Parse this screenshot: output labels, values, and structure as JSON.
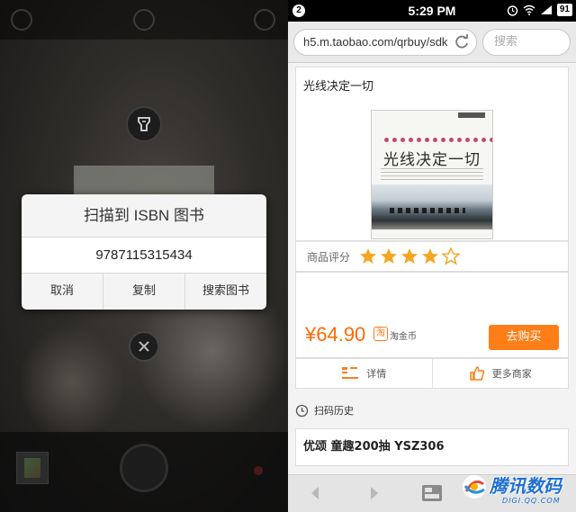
{
  "scanner": {
    "dialog_title": "扫描到 ISBN 图书",
    "isbn": "9787115315434",
    "buttons": [
      "取消",
      "复制",
      "搜索图书"
    ]
  },
  "status_bar": {
    "notification_count": "2",
    "time": "5:29 PM",
    "battery": "91"
  },
  "browser": {
    "url": "h5.m.taobao.com/qrbuy/sdk",
    "search_placeholder": "搜索"
  },
  "product": {
    "title": "光线决定一切",
    "cover_title": "光线决定一切",
    "rating_label": "商品评分",
    "rating": 4,
    "rating_max": 5,
    "price": "¥64.90",
    "coin_icon": "淘",
    "coin_label": "淘金币",
    "buy_label": "去购买",
    "tab_details": "详情",
    "tab_more_sellers": "更多商家"
  },
  "history": {
    "heading": "扫码历史",
    "item": "优颂  童趣200抽  YSZ306"
  },
  "watermark": {
    "text": "腾讯数码",
    "sub": "DIGI.QQ.COM"
  },
  "colors": {
    "accent_orange": "#ff7e17",
    "price_orange": "#ff6a00",
    "star": "#f5a623"
  }
}
